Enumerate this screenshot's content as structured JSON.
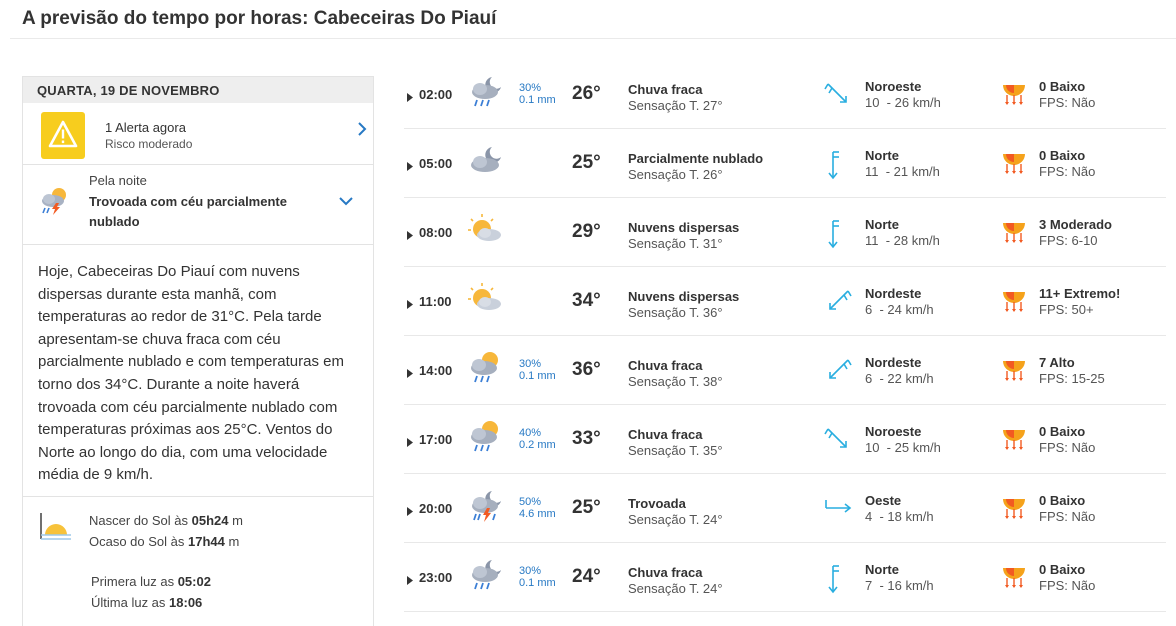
{
  "page": {
    "title": "A previsão do tempo por horas: Cabeceiras Do Piauí"
  },
  "left": {
    "day_header": "QUARTA, 19 DE NOVEMBRO",
    "alert": {
      "title": "1 Alerta agora",
      "subtitle": "Risco moderado",
      "icon": "warning-icon"
    },
    "night": {
      "label": "Pela noite",
      "description": "Trovoada com céu parcialmente nublado",
      "icon": "thunderstorm-partly-cloudy-icon"
    },
    "summary": "Hoje, Cabeceiras Do Piauí com nuvens dispersas durante esta manhã, com temperaturas ao redor de 31°C. Pela tarde apresentam-se chuva fraca com céu parcialmente nublado e com temperaturas em torno dos 34°C. Durante a noite haverá trovoada com céu parcialmente nublado com temperaturas próximas aos 25°C. Ventos do Norte ao longo do dia, com uma velocidade média de 9 km/h.",
    "sun": {
      "sunrise_label": "Nascer do Sol às ",
      "sunrise_time": "05h24",
      "sunrise_unit": " m",
      "sunset_label": "Ocaso do Sol às ",
      "sunset_time": "17h44",
      "sunset_unit": " m",
      "firstlight_label": "Primera luz as ",
      "firstlight_time": "05:02",
      "lastlight_label": "Última luz as ",
      "lastlight_time": "18:06"
    }
  },
  "hours": [
    {
      "time": "02:00",
      "icon": "night-rain-icon",
      "prob": "30%",
      "precip": "0.1 mm",
      "temp": "26°",
      "cond": "Chuva fraca",
      "feels": "Sensação T. 27°",
      "wind_dir": "Noroeste",
      "wind_speed": "10  - 26 km/h",
      "wind_icon": "wind-northwest-icon",
      "uv": "0 Baixo",
      "fps": "FPS: Não"
    },
    {
      "time": "05:00",
      "icon": "night-cloudy-icon",
      "prob": "",
      "precip": "",
      "temp": "25°",
      "cond": "Parcialmente nublado",
      "feels": "Sensação T. 26°",
      "wind_dir": "Norte",
      "wind_speed": "11  - 21 km/h",
      "wind_icon": "wind-north-icon",
      "uv": "0 Baixo",
      "fps": "FPS: Não"
    },
    {
      "time": "08:00",
      "icon": "sun-cloud-icon",
      "prob": "",
      "precip": "",
      "temp": "29°",
      "cond": "Nuvens dispersas",
      "feels": "Sensação T. 31°",
      "wind_dir": "Norte",
      "wind_speed": "11  - 28 km/h",
      "wind_icon": "wind-north-icon",
      "uv": "3 Moderado",
      "fps": "FPS: 6-10"
    },
    {
      "time": "11:00",
      "icon": "sun-cloud-icon",
      "prob": "",
      "precip": "",
      "temp": "34°",
      "cond": "Nuvens dispersas",
      "feels": "Sensação T. 36°",
      "wind_dir": "Nordeste",
      "wind_speed": "6  - 24 km/h",
      "wind_icon": "wind-northeast-icon",
      "uv": "11+ Extremo!",
      "fps": "FPS: 50+"
    },
    {
      "time": "14:00",
      "icon": "sun-rain-icon",
      "prob": "30%",
      "precip": "0.1 mm",
      "temp": "36°",
      "cond": "Chuva fraca",
      "feels": "Sensação T. 38°",
      "wind_dir": "Nordeste",
      "wind_speed": "6  - 22 km/h",
      "wind_icon": "wind-northeast-icon",
      "uv": "7 Alto",
      "fps": "FPS: 15-25"
    },
    {
      "time": "17:00",
      "icon": "sun-rain-icon",
      "prob": "40%",
      "precip": "0.2 mm",
      "temp": "33°",
      "cond": "Chuva fraca",
      "feels": "Sensação T. 35°",
      "wind_dir": "Noroeste",
      "wind_speed": "10  - 25 km/h",
      "wind_icon": "wind-northwest-icon",
      "uv": "0 Baixo",
      "fps": "FPS: Não"
    },
    {
      "time": "20:00",
      "icon": "night-thunderstorm-icon",
      "prob": "50%",
      "precip": "4.6 mm",
      "temp": "25°",
      "cond": "Trovoada",
      "feels": "Sensação T. 24°",
      "wind_dir": "Oeste",
      "wind_speed": "4  - 18 km/h",
      "wind_icon": "wind-west-icon",
      "uv": "0 Baixo",
      "fps": "FPS: Não"
    },
    {
      "time": "23:00",
      "icon": "night-rain-icon",
      "prob": "30%",
      "precip": "0.1 mm",
      "temp": "24°",
      "cond": "Chuva fraca",
      "feels": "Sensação T. 24°",
      "wind_dir": "Norte",
      "wind_speed": "7  - 16 km/h",
      "wind_icon": "wind-north-icon",
      "uv": "0 Baixo",
      "fps": "FPS: Não"
    }
  ],
  "colors": {
    "accent": "#2779c4",
    "wind_arrow": "#29aee0",
    "alert": "#f7cd1e",
    "uv_sun": "#f5a21b"
  }
}
